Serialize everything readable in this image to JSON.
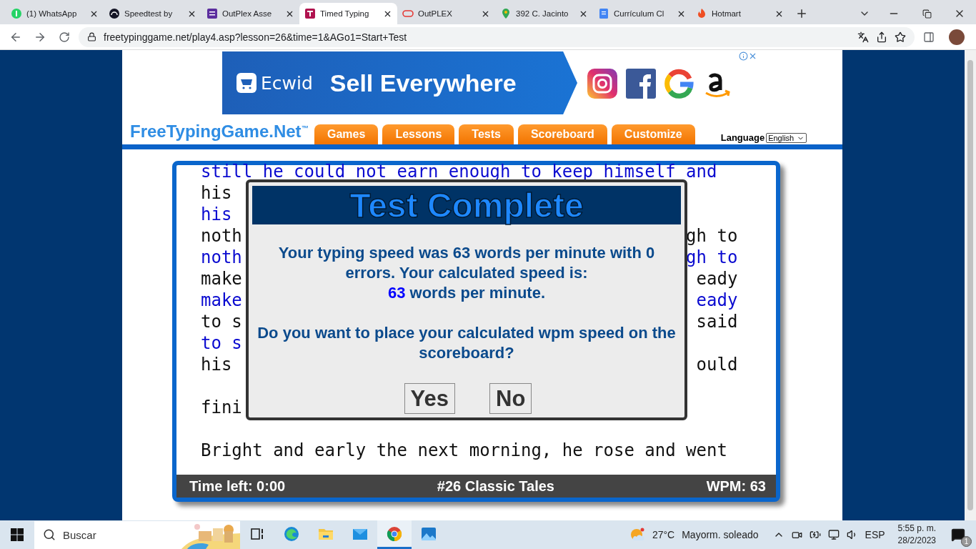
{
  "browser": {
    "tabs": [
      {
        "title": "(1) WhatsApp",
        "selected": false
      },
      {
        "title": "Speedtest by",
        "selected": false
      },
      {
        "title": "OutPlex Asse",
        "selected": false
      },
      {
        "title": "Timed Typing",
        "selected": true
      },
      {
        "title": "OutPLEX",
        "selected": false
      },
      {
        "title": "392 C. Jacinto",
        "selected": false
      },
      {
        "title": "Currículum Cl",
        "selected": false
      },
      {
        "title": "Hotmart",
        "selected": false
      }
    ],
    "url": "freetypinggame.net/play4.asp?lesson=26&time=1&AGo1=Start+Test"
  },
  "ad": {
    "brand": "Ecwid",
    "headline": "Sell Everywhere"
  },
  "site": {
    "logo": "FreeTypingGame.Net$^{™}$",
    "nav": [
      "Games",
      "Lessons",
      "Tests",
      "Scoreboard",
      "Customize"
    ],
    "language_label": "Language",
    "language_value": "English"
  },
  "typing": {
    "lines": [
      {
        "kind": "text",
        "left": "still he could not earn enough to keep himself and",
        "typed": true
      },
      {
        "kind": "text",
        "left": "his",
        "typed": false
      },
      {
        "kind": "text",
        "left": "his",
        "typed": true
      },
      {
        "kind": "text",
        "left": "noth",
        "right": "gh to",
        "typed": false
      },
      {
        "kind": "text",
        "left": "noth",
        "right": "gh to",
        "typed": true
      },
      {
        "kind": "text",
        "left": "make",
        "right": "eady",
        "typed": false
      },
      {
        "kind": "text",
        "left": "make",
        "right": "eady",
        "typed": true
      },
      {
        "kind": "text",
        "left": "to s",
        "right": "said",
        "typed": false
      },
      {
        "kind": "text",
        "left": "to s",
        "typed": true
      },
      {
        "kind": "text",
        "left": "his",
        "right": "ould",
        "typed": false
      },
      {
        "kind": "blank"
      },
      {
        "kind": "text",
        "left": "fini",
        "typed": false
      },
      {
        "kind": "blank"
      },
      {
        "kind": "text",
        "left": "Bright and early the next morning, he rose and went",
        "typed": false
      }
    ],
    "status": {
      "time_left": "Time left: 0:00",
      "lesson": "#26 Classic Tales",
      "wpm": "WPM: 63"
    }
  },
  "dialog": {
    "title": "Test Complete",
    "message": "Your typing speed was 63 words per minute with 0 errors. Your calculated speed is:",
    "speed": "63",
    "speed_suffix": " words per minute.",
    "question": "Do you want to place your calculated wpm speed on the scoreboard?",
    "buttons": [
      "Yes",
      "No"
    ]
  },
  "taskbar": {
    "search_placeholder": "Buscar",
    "apps": [
      {
        "kind": "taskview",
        "selected": false
      },
      {
        "kind": "edge",
        "selected": false
      },
      {
        "kind": "folder",
        "selected": false
      },
      {
        "kind": "mail",
        "selected": false
      },
      {
        "kind": "chrome",
        "selected": true
      },
      {
        "kind": "photos",
        "selected": false
      }
    ],
    "temperature": "27°C",
    "weather": "Mayorm. soleado",
    "language": "ESP",
    "time": "5:55 p. m.",
    "date": "28/2/2023",
    "notifications": "1"
  }
}
